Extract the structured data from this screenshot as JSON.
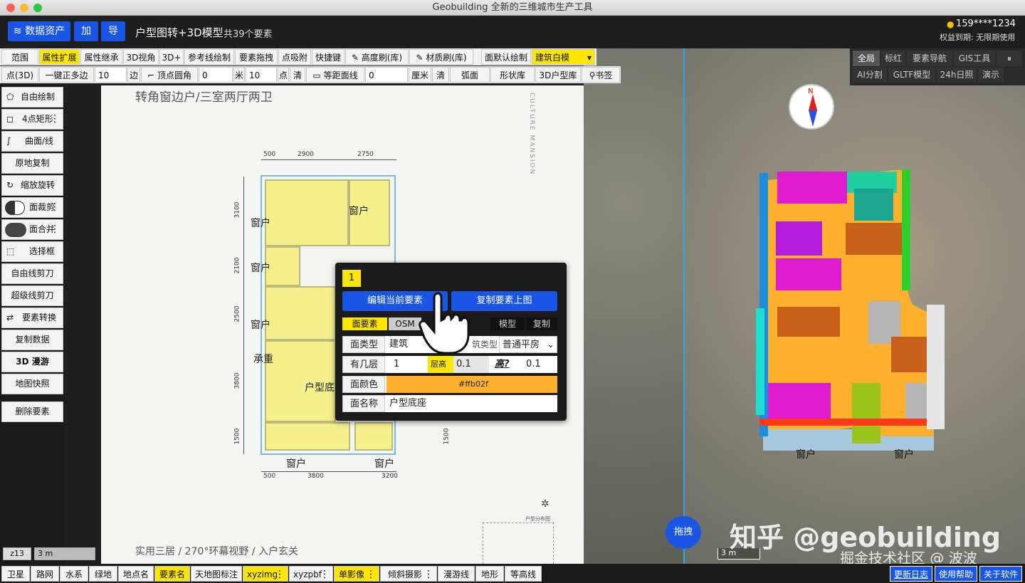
{
  "window": {
    "title": "Geobuilding 全新的三维城市生产工具"
  },
  "header": {
    "data_assets": "数据资产",
    "add": "加",
    "import": "导",
    "project_title": "户型图转+3D模型",
    "element_count": "共39个要素",
    "user": "159****1234",
    "expiry": "权益到期: 无限期使用"
  },
  "toolbar1": [
    "范围",
    "属性扩展",
    "属性继承",
    "3D视角",
    "3D+",
    "参考线绘制",
    "要素拖拽",
    "点吸附",
    "快捷键",
    "高度刷(库)",
    "材质刷(库)",
    "面默认绘制"
  ],
  "toolbar1_select": "建筑白模",
  "toolbar2": {
    "point3d": "点(3D)",
    "polygon_label": "一键正多边",
    "polygon_value": "10",
    "edge": "边",
    "corner_label": "顶点圆角",
    "corner_value": "0",
    "meter": "米",
    "points_value": "10",
    "points": "点",
    "clear1": "清",
    "equidist_label": "等距面线",
    "equidist_value": "0",
    "cm": "厘米",
    "clear2": "清",
    "arc": "弧面",
    "shape_lib": "形状库",
    "lib3d": "3D户型库",
    "bookmark": "书签"
  },
  "right_tabs_row1": [
    "全局",
    "标红",
    "要素导航",
    "GIS工具"
  ],
  "right_tabs_row2": [
    "AI分割",
    "GLTF模型",
    "24h日照",
    "演示"
  ],
  "left_tools": [
    "自由绘制",
    "4点矩形",
    "曲面/线",
    "原地复制",
    "缩放旋转",
    "面裁剪",
    "面合并",
    "选择框",
    "自由线剪刀",
    "超级线剪刀",
    "要素转换",
    "复制数据",
    "3D 漫游",
    "地图快照",
    "删除要素"
  ],
  "floorplan": {
    "title": "转角窗边户/三室两厅两卫",
    "caption": "实用三居 / 270°环幕视野 / 入户玄关",
    "vertical_text": "CULTURE MANSION",
    "dims_top": [
      "500",
      "2900",
      "2750"
    ],
    "dims_bottom": [
      "500",
      "3800",
      "3200"
    ],
    "dims_left": [
      "3100",
      "2100",
      "2500",
      "3800",
      "1500"
    ],
    "dims_right": [
      "1500"
    ],
    "labels": [
      "窗户",
      "窗户",
      "窗户",
      "窗户",
      "承重",
      "户型底",
      "窗户",
      "窗户"
    ],
    "location_label": "户型分布图"
  },
  "popup": {
    "index": "1",
    "edit_btn": "编辑当前要素",
    "copy_btn": "复制要素上图",
    "tab_face": "面要素",
    "tab_osm": "OSM",
    "tab_model": "模型",
    "tab_copy": "复制",
    "face_type_label": "面类型",
    "face_type_value": "建筑",
    "building_type_label": "筑类型",
    "building_type_value": "普通平房",
    "floors_label": "有几层",
    "floors_value": "1",
    "floor_height_label": "层高",
    "floor_height_value": "0.1",
    "height_label": "高?",
    "height_value": "0.1",
    "color_label": "面颜色",
    "color_value": "#ffb02f",
    "name_label": "面名称",
    "name_value": "户型底座"
  },
  "map": {
    "drag_btn": "拖拽",
    "scale_right": "3 m",
    "window_labels": [
      "窗户",
      "窗户"
    ],
    "compass_n": "N"
  },
  "status": {
    "zoom": "z13",
    "scale": "3 m"
  },
  "bottom_tabs": [
    "卫星",
    "路网",
    "水系",
    "绿地",
    "地点名",
    "要素名",
    "天地图标注",
    "xyzimg",
    "xyzpbf",
    "单影像",
    "倾斜摄影",
    "漫游线",
    "地形",
    "等高线"
  ],
  "bottom_right": [
    "更新日志",
    "使用帮助",
    "关于软件"
  ],
  "watermark": {
    "line1": "知乎 @geobuilding",
    "line2": "掘金技术社区 @ 波波"
  },
  "colors": {
    "accent": "#1a56e6",
    "highlight": "#ffe600",
    "face_color": "#ffb02f",
    "magenta": "#e01bd0"
  }
}
